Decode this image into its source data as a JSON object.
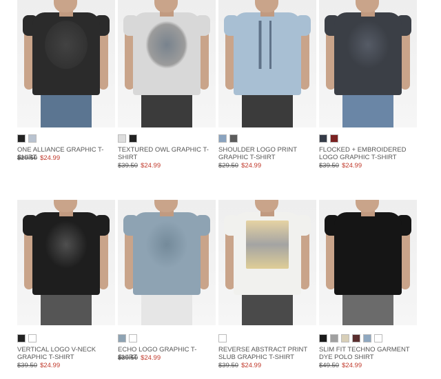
{
  "products": [
    {
      "name": "ONE ALLIANCE GRAPHIC T-SHIRT",
      "old_price": "$29.50",
      "new_price": "$24.99",
      "shirt": "#2b2b2b",
      "pants": "#5b7591",
      "swatches": [
        "#222222",
        "#b9c3d0"
      ]
    },
    {
      "name": "TEXTURED OWL GRAPHIC T-SHIRT",
      "old_price": "$39.50",
      "new_price": "$24.99",
      "shirt": "#d8d8d8",
      "pants": "#3b3b3b",
      "swatches": [
        "#dddddd",
        "#222222"
      ]
    },
    {
      "name": "SHOULDER LOGO PRINT GRAPHIC T-SHIRT",
      "old_price": "$29.50",
      "new_price": "$24.99",
      "shirt": "#a8bfd3",
      "pants": "#3b3b3b",
      "swatches": [
        "#8aa3bf",
        "#5c5c5c"
      ]
    },
    {
      "name": "FLOCKED + EMBROIDERED LOGO GRAPHIC T-SHIRT",
      "old_price": "$39.50",
      "new_price": "$24.99",
      "shirt": "#3b3f46",
      "pants": "#6a86a6",
      "swatches": [
        "#353b47",
        "#7a2222"
      ]
    },
    {
      "name": "VERTICAL LOGO V-NECK GRAPHIC T-SHIRT",
      "old_price": "$39.50",
      "new_price": "$24.99",
      "shirt": "#1e1e1e",
      "pants": "#555555",
      "swatches": [
        "#222222",
        "#ffffff"
      ]
    },
    {
      "name": "ECHO LOGO GRAPHIC T-SHIRT",
      "old_price": "$39.50",
      "new_price": "$24.99",
      "shirt": "#8ea3b3",
      "pants": "#e6e6e6",
      "swatches": [
        "#8ea3b3",
        "#ffffff"
      ]
    },
    {
      "name": "REVERSE ABSTRACT PRINT SLUB GRAPHIC T-SHIRT",
      "old_price": "$39.50",
      "new_price": "$24.99",
      "shirt": "#f1f1ee",
      "pants": "#4a4a4a",
      "swatches": [
        "#ffffff"
      ]
    },
    {
      "name": "SLIM FIT TECHNO GARMENT DYE POLO SHIRT",
      "old_price": "$49.50",
      "new_price": "$24.99",
      "shirt": "#151515",
      "pants": "#6b6b6b",
      "swatches": [
        "#1a1a1a",
        "#a0a0a0",
        "#d8cfb8",
        "#5a2e2e",
        "#8fa8c0",
        "#ffffff"
      ]
    }
  ],
  "colors": {
    "sale": "#c0392b",
    "text": "#555555"
  },
  "icons": [
    "product-photo"
  ]
}
